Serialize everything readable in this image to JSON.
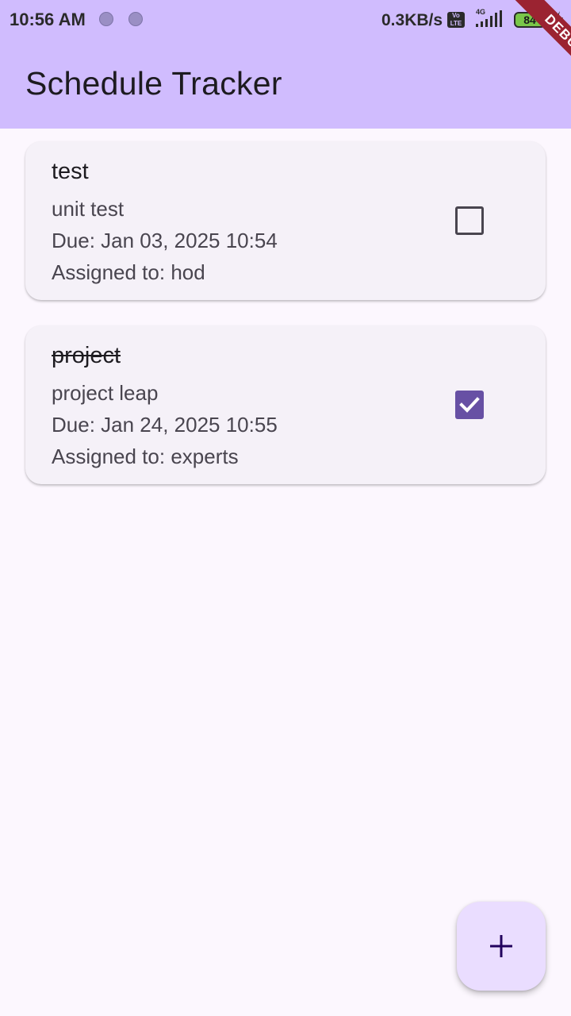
{
  "status_bar": {
    "time": "10:56 AM",
    "net_speed": "0.3KB/s",
    "volte_top": "Vo",
    "volte_bottom": "LTE",
    "network": "4G",
    "battery": "84"
  },
  "debug_banner": "DEBUG",
  "app_bar": {
    "title": "Schedule Tracker"
  },
  "tasks": [
    {
      "title": "test",
      "description": "unit test",
      "due": "Due: Jan 03, 2025 10:54",
      "assigned": "Assigned to: hod",
      "completed": false
    },
    {
      "title": "project",
      "description": "project leap",
      "due": "Due: Jan 24, 2025 10:55",
      "assigned": "Assigned to: experts",
      "completed": true
    }
  ],
  "fab": {
    "icon": "plus-icon"
  },
  "colors": {
    "app_bar": "#d0bcfe",
    "background": "#fcf7fe",
    "card": "#f5f1f8",
    "checkbox_checked": "#6750a4",
    "fab": "#eaddff"
  }
}
